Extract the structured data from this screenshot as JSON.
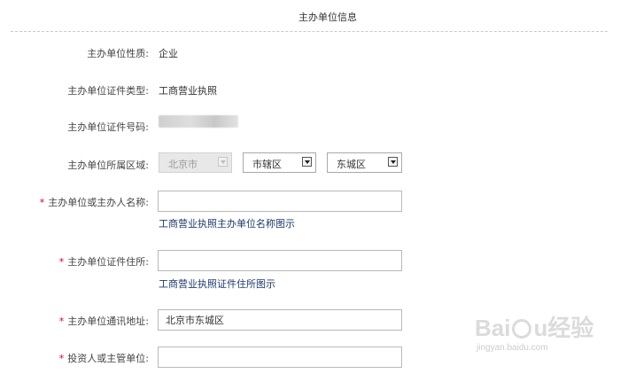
{
  "page": {
    "title": "主办单位信息"
  },
  "form": {
    "nature": {
      "label": "主办单位性质:",
      "value": "企业"
    },
    "cert_type": {
      "label": "主办单位证件类型:",
      "value": "工商营业执照"
    },
    "cert_no": {
      "label": "主办单位证件号码:"
    },
    "region": {
      "label": "主办单位所属区域:",
      "province": "北京市",
      "city": "市辖区",
      "district": "东城区"
    },
    "name": {
      "required_mark": "*",
      "label": "主办单位或主办人名称:",
      "value": "",
      "hint_link": "工商营业执照主办单位名称图示"
    },
    "address": {
      "required_mark": "*",
      "label": "主办单位证件住所:",
      "value": "",
      "hint_link": "工商营业执照证件住所图示"
    },
    "mail_address": {
      "required_mark": "*",
      "label": "主办单位通讯地址:",
      "value": "北京市东城区"
    },
    "investor": {
      "required_mark": "*",
      "label": "投资人或主管单位:",
      "value": ""
    }
  },
  "watermark": {
    "brand_left": "Bai",
    "brand_right": "u",
    "brand_cn": "经验",
    "site": "jingyan.baidu.com"
  }
}
